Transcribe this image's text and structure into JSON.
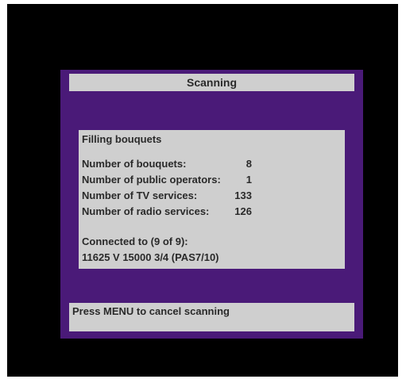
{
  "dialog": {
    "title": "Scanning",
    "status": "Filling bouquets",
    "stats": [
      {
        "label": "Number of bouquets:",
        "value": "8"
      },
      {
        "label": "Number of public operators:",
        "value": "1"
      },
      {
        "label": "Number of TV services:",
        "value": "133"
      },
      {
        "label": "Number of radio services:",
        "value": "126"
      }
    ],
    "connection_line": "Connected to (9 of 9):",
    "transponder_line": "11625 V  15000  3/4  (PAS7/10)",
    "footer_hint": "Press MENU to cancel scanning"
  },
  "colors": {
    "dialog_background": "#4a1a78",
    "panel_background": "#cfcfcf",
    "screen_background": "#000000",
    "text": "#2a2a2a"
  }
}
